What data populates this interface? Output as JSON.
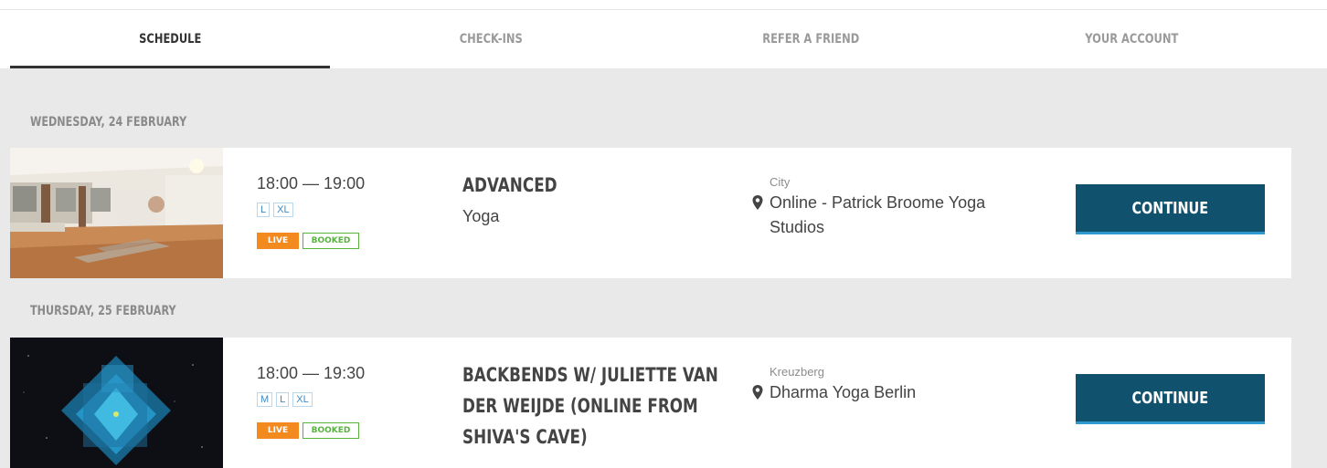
{
  "nav": {
    "tabs": [
      {
        "label": "SCHEDULE",
        "active": true
      },
      {
        "label": "CHECK-INS",
        "active": false
      },
      {
        "label": "REFER A FRIEND",
        "active": false
      },
      {
        "label": "YOUR ACCOUNT",
        "active": false
      }
    ]
  },
  "days": [
    {
      "date": "WEDNESDAY, 24 FEBRUARY",
      "classes": [
        {
          "time": "18:00 — 19:00",
          "sizes": [
            "L",
            "XL"
          ],
          "live_badge": "LIVE",
          "booked_badge": "BOOKED",
          "title": "ADVANCED",
          "type": "Yoga",
          "region": "City",
          "venue": "Online - Patrick Broome Yoga Studios",
          "button": "CONTINUE",
          "location_icon": "map-pin-icon"
        }
      ]
    },
    {
      "date": "THURSDAY, 25 FEBRUARY",
      "classes": [
        {
          "time": "18:00 — 19:30",
          "sizes": [
            "M",
            "L",
            "XL"
          ],
          "live_badge": "LIVE",
          "booked_badge": "BOOKED",
          "title": "BACKBENDS W/ JULIETTE VAN DER WEIJDE (ONLINE FROM SHIVA'S CAVE)",
          "type": "",
          "region": "Kreuzberg",
          "venue": "Dharma Yoga Berlin",
          "button": "CONTINUE",
          "location_icon": "map-pin-icon"
        }
      ]
    }
  ],
  "colors": {
    "accent_button": "#10526d",
    "button_underline": "#2f9ad0",
    "live_badge": "#f28a1e",
    "booked_badge": "#57b33e",
    "size_tag": "#3d8bc4",
    "background": "#e9e9e9"
  }
}
